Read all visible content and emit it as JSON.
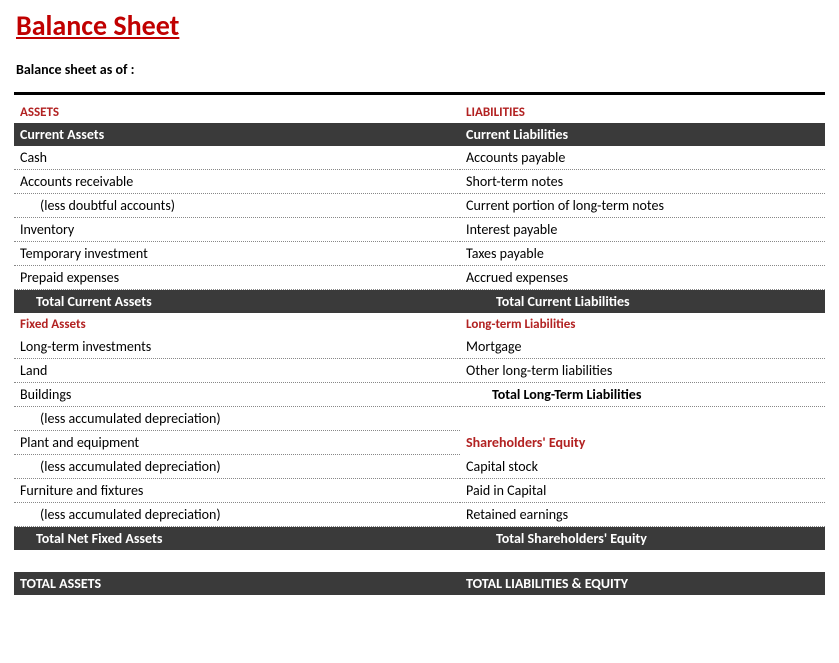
{
  "title": "Balance Sheet",
  "subtitle": "Balance sheet as of :",
  "assets": {
    "header": "ASSETS",
    "current": {
      "label": "Current Assets",
      "items": [
        "Cash",
        "Accounts receivable",
        "(less doubtful accounts)",
        "Inventory",
        "Temporary investment",
        "Prepaid expenses"
      ],
      "total": "Total Current Assets"
    },
    "fixed": {
      "label": "Fixed Assets",
      "items": [
        "Long-term investments",
        "Land",
        "Buildings",
        "(less accumulated depreciation)",
        "Plant and equipment",
        "(less accumulated depreciation)",
        "Furniture and fixtures",
        "(less accumulated depreciation)"
      ],
      "total": "Total Net Fixed Assets"
    },
    "grand_total": "TOTAL ASSETS"
  },
  "liabilities": {
    "header": "LIABILITIES",
    "current": {
      "label": "Current Liabilities",
      "items": [
        "Accounts payable",
        "Short-term notes",
        "Current portion of long-term notes",
        "Interest payable",
        "Taxes payable",
        "Accrued expenses"
      ],
      "total": "Total Current Liabilities"
    },
    "longterm": {
      "label": "Long-term Liabilities",
      "items": [
        "Mortgage",
        "Other long-term liabilities"
      ],
      "total": "Total Long-Term Liabilities"
    },
    "equity": {
      "label": "Shareholders' Equity",
      "items": [
        "Capital stock",
        "Paid in Capital",
        "Retained earnings"
      ],
      "total": "Total Shareholders' Equity"
    },
    "grand_total": "TOTAL LIABILITIES & EQUITY"
  }
}
